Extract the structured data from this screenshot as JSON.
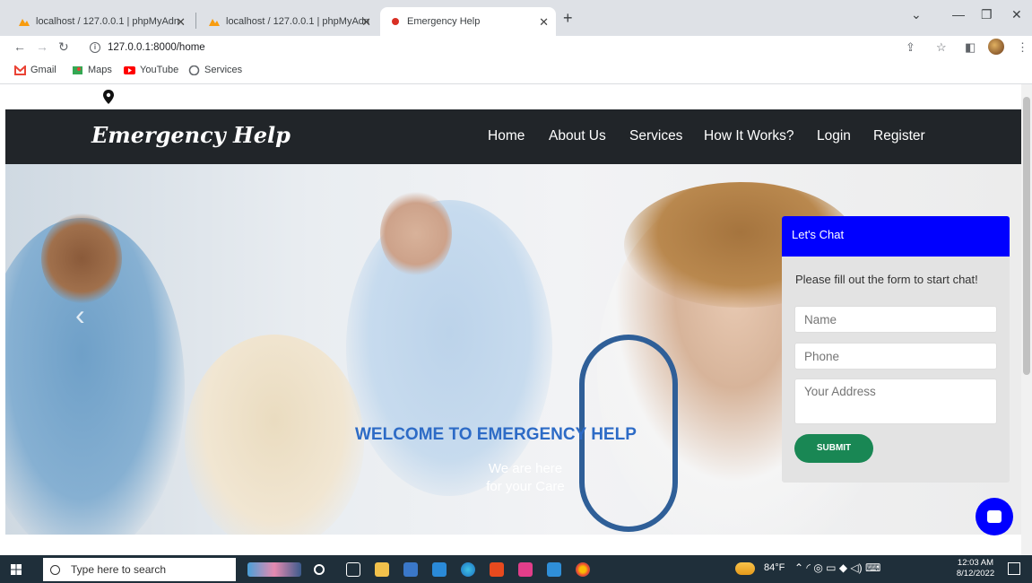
{
  "browser": {
    "tabs": [
      {
        "title": "localhost / 127.0.0.1 | phpMyAdn",
        "active": false
      },
      {
        "title": "localhost / 127.0.0.1 | phpMyAdn",
        "active": false
      },
      {
        "title": "Emergency Help",
        "active": true
      }
    ],
    "url": "127.0.0.1:8000/home",
    "bookmarks": [
      "Gmail",
      "Maps",
      "YouTube",
      "Services"
    ]
  },
  "site": {
    "brand": "Emergency Help",
    "nav": [
      "Home",
      "About Us",
      "Services",
      "How It Works?",
      "Login",
      "Register"
    ],
    "hero": {
      "heading": "WELCOME TO EMERGENCY HELP",
      "tagline_line1": "We are here",
      "tagline_line2": "for your Care"
    },
    "chat": {
      "header": "Let's Chat",
      "intro": "Please fill out the form to start chat!",
      "name_placeholder": "Name",
      "phone_placeholder": "Phone",
      "address_placeholder": "Your Address",
      "submit_label": "SUBMIT"
    }
  },
  "taskbar": {
    "search_placeholder": "Type here to search",
    "weather": "84°F",
    "time": "12:03 AM",
    "date": "8/12/2022"
  },
  "colors": {
    "navbar": "#212529",
    "chat_header": "#0000ff",
    "submit": "#198754",
    "welcome_text": "#2d6bc6"
  }
}
